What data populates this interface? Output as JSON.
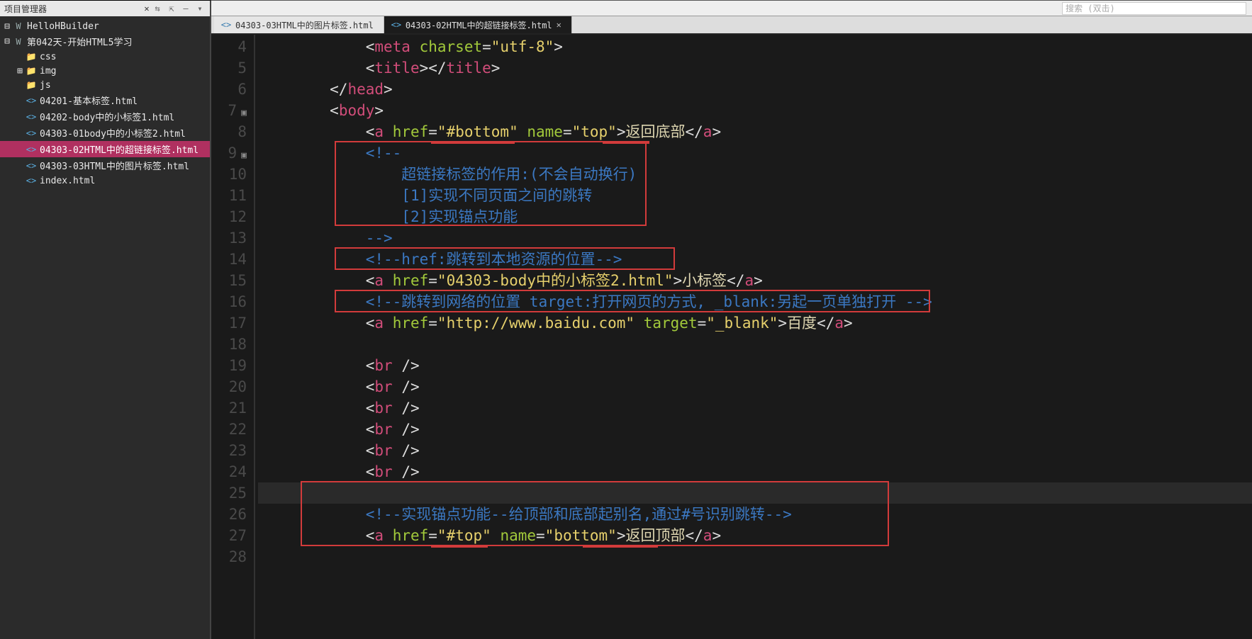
{
  "sidebar": {
    "title": "项目管理器",
    "close": "✕",
    "tree": [
      {
        "label": "HelloHBuilder",
        "indent": 0,
        "twisty": "⊟",
        "icon": "W",
        "iconClass": "ico-folder-w"
      },
      {
        "label": "第042天-开始HTML5学习",
        "indent": 0,
        "twisty": "⊟",
        "icon": "W",
        "iconClass": "ico-folder-w"
      },
      {
        "label": "css",
        "indent": 1,
        "twisty": "",
        "icon": "📁",
        "iconClass": "ico-folder"
      },
      {
        "label": "img",
        "indent": 1,
        "twisty": "⊞",
        "icon": "📁",
        "iconClass": "ico-folder"
      },
      {
        "label": "js",
        "indent": 1,
        "twisty": "",
        "icon": "📁",
        "iconClass": "ico-folder"
      },
      {
        "label": "04201-基本标签.html",
        "indent": 1,
        "twisty": "",
        "icon": "<>",
        "iconClass": "ico-html"
      },
      {
        "label": "04202-body中的小标签1.html",
        "indent": 1,
        "twisty": "",
        "icon": "<>",
        "iconClass": "ico-html"
      },
      {
        "label": "04303-01body中的小标签2.html",
        "indent": 1,
        "twisty": "",
        "icon": "<>",
        "iconClass": "ico-html"
      },
      {
        "label": "04303-02HTML中的超链接标签.html",
        "indent": 1,
        "twisty": "",
        "icon": "<>",
        "iconClass": "ico-html",
        "active": true
      },
      {
        "label": "04303-03HTML中的图片标签.html",
        "indent": 1,
        "twisty": "",
        "icon": "<>",
        "iconClass": "ico-html"
      },
      {
        "label": "index.html",
        "indent": 1,
        "twisty": "",
        "icon": "<>",
        "iconClass": "ico-html"
      }
    ]
  },
  "tabs": [
    {
      "label": "04303-03HTML中的图片标签.html",
      "active": false
    },
    {
      "label": "04303-02HTML中的超链接标签.html",
      "active": true
    }
  ],
  "searchPlaceholder": "搜索 (双击)",
  "gutterStart": 4,
  "gutterEnd": 28,
  "foldLines": [
    7,
    9
  ],
  "currentLine": 25,
  "code": {
    "l4": {
      "indent": 3,
      "open": "meta",
      "attrs": [
        [
          "charset",
          "utf-8"
        ]
      ],
      "selfSlash": false,
      "close": ""
    },
    "l5": {
      "indent": 3,
      "open": "title",
      "close": "title"
    },
    "l6": {
      "indent": 2,
      "closeOnly": "head"
    },
    "l7": {
      "indent": 2,
      "open": "body"
    },
    "l8": {
      "indent": 3,
      "open": "a",
      "attrs": [
        [
          "href",
          "#bottom"
        ],
        [
          "name",
          "top"
        ]
      ],
      "text": "返回底部",
      "close": "a"
    },
    "l9": {
      "indent": 3,
      "commentOpen": "<!--"
    },
    "l10": {
      "indent": 4,
      "commentText": "超链接标签的作用:(不会自动换行)"
    },
    "l11": {
      "indent": 4,
      "commentText": "[1]实现不同页面之间的跳转"
    },
    "l12": {
      "indent": 4,
      "commentText": "[2]实现锚点功能"
    },
    "l13": {
      "indent": 3,
      "commentClose": "-->"
    },
    "l14": {
      "indent": 3,
      "commentFull": "<!--href:跳转到本地资源的位置-->"
    },
    "l15": {
      "indent": 3,
      "open": "a",
      "attrs": [
        [
          "href",
          "04303-body中的小标签2.html"
        ]
      ],
      "text": "小标签",
      "close": "a"
    },
    "l16": {
      "indent": 3,
      "commentFull": "<!--跳转到网络的位置 target:打开网页的方式, _blank:另起一页单独打开 -->"
    },
    "l17": {
      "indent": 3,
      "open": "a",
      "attrs": [
        [
          "href",
          "http://www.baidu.com"
        ],
        [
          "target",
          "_blank"
        ]
      ],
      "text": "百度",
      "close": "a"
    },
    "l18": {
      "indent": 3,
      "blank": true
    },
    "l19": {
      "indent": 3,
      "selfClose": "br"
    },
    "l20": {
      "indent": 3,
      "selfClose": "br"
    },
    "l21": {
      "indent": 3,
      "selfClose": "br"
    },
    "l22": {
      "indent": 3,
      "selfClose": "br"
    },
    "l23": {
      "indent": 3,
      "selfClose": "br"
    },
    "l24": {
      "indent": 3,
      "selfClose": "br"
    },
    "l25": {
      "indent": 3,
      "blank": true
    },
    "l26": {
      "indent": 3,
      "commentFull": "<!--实现锚点功能--给顶部和底部起别名,通过#号识别跳转-->"
    },
    "l27": {
      "indent": 3,
      "open": "a",
      "attrs": [
        [
          "href",
          "#top"
        ],
        [
          "name",
          "bottom"
        ]
      ],
      "text": "返回顶部",
      "close": "a"
    },
    "l28": {
      "indent": 3,
      "blank": true
    }
  }
}
